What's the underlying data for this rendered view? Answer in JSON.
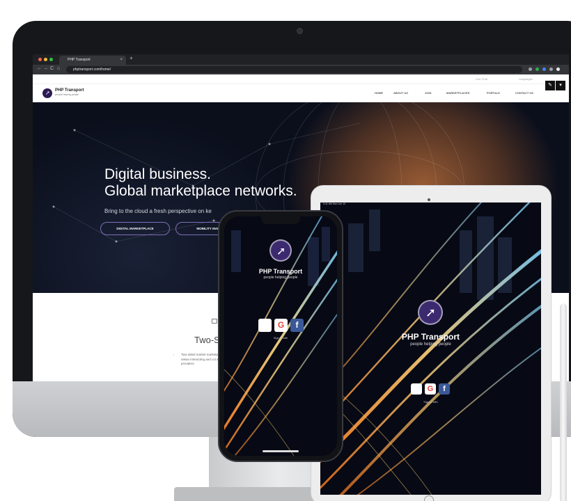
{
  "browser": {
    "tab_title": "PHP Transport",
    "tab_close": "×",
    "new_tab": "+",
    "url": "phptransport.com/home/",
    "back": "←",
    "forward": "→",
    "reload": "C",
    "home": "⌂"
  },
  "site": {
    "logo_name": "PHP Transport",
    "logo_tagline": "people helping people",
    "top_links": [
      "Live Chat",
      "Languages"
    ],
    "menu": [
      "HOME",
      "ABOUT US",
      "JOIN",
      "MARKETPLACES",
      "PORTALS",
      "CONTACT US"
    ],
    "hero_title_line1": "Digital business.",
    "hero_title_line2": "Global marketplace networks.",
    "hero_subtitle": "Bring to the cloud a fresh perspective on ke",
    "hero_buttons": [
      "DIGITAL MARKETPLACE",
      "MOBILITY MARKE"
    ],
    "section_title": "Two-S",
    "section_text": "Two-sided market marketplace netwo interacting and col service providers."
  },
  "phone": {
    "app_name": "PHP Transport",
    "app_tagline": "people helping people",
    "social": [
      "",
      "G",
      "f"
    ],
    "link": "Sign in with"
  },
  "tablet": {
    "status": "9:41 AM   Mon Jun 10",
    "app_name": "PHP Transport",
    "app_tagline": "people helping people",
    "social": [
      "",
      "G",
      "f"
    ],
    "link": "Sign in with"
  },
  "colors": {
    "brand_purple": "#3b2a6e",
    "hero_button_border": "#7e6fb8",
    "browser_dark": "#202124"
  }
}
